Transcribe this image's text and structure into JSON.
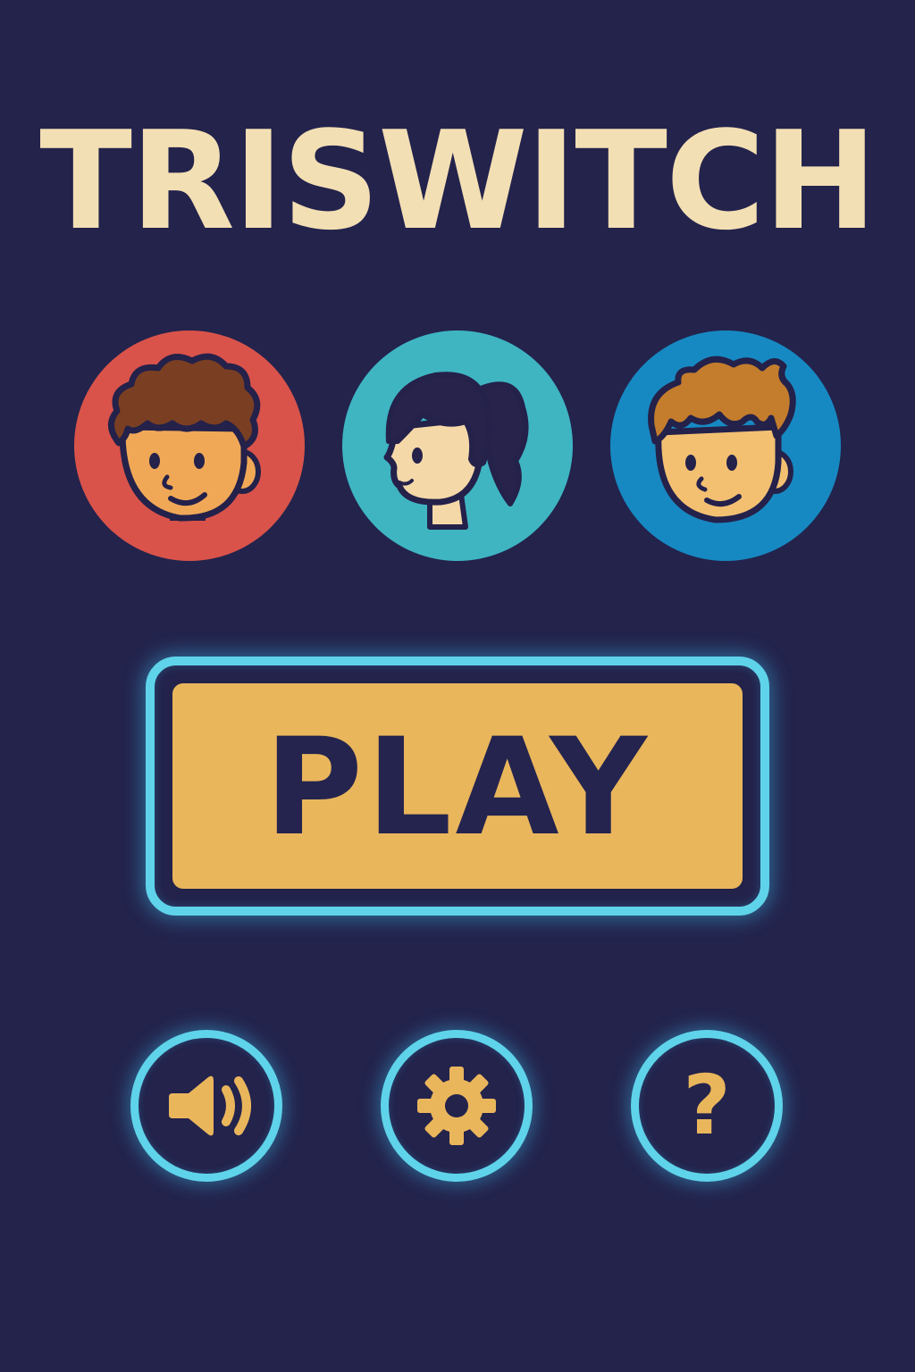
{
  "title": "TRISWITCH",
  "characters": [
    {
      "name": "curly-hair-boy",
      "bg_color": "#d9534a",
      "skin": "#f0a857",
      "hair": "#7a3f22"
    },
    {
      "name": "ponytail-girl",
      "bg_color": "#3fb5c2",
      "skin": "#f4d8a8",
      "hair": "#27234a"
    },
    {
      "name": "spiky-hair-boy",
      "bg_color": "#1789c2",
      "skin": "#f3c072",
      "hair": "#c47d2c"
    }
  ],
  "play_button": {
    "label": "PLAY"
  },
  "bottom_buttons": {
    "sound": {
      "icon": "speaker-icon"
    },
    "settings": {
      "icon": "gear-icon"
    },
    "help": {
      "icon": "question-icon",
      "glyph": "?"
    }
  },
  "colors": {
    "background": "#23234c",
    "title": "#f3dfb4",
    "accent_glow": "#5fd3ea",
    "button_fill": "#eab65c",
    "outline": "#22224a"
  }
}
